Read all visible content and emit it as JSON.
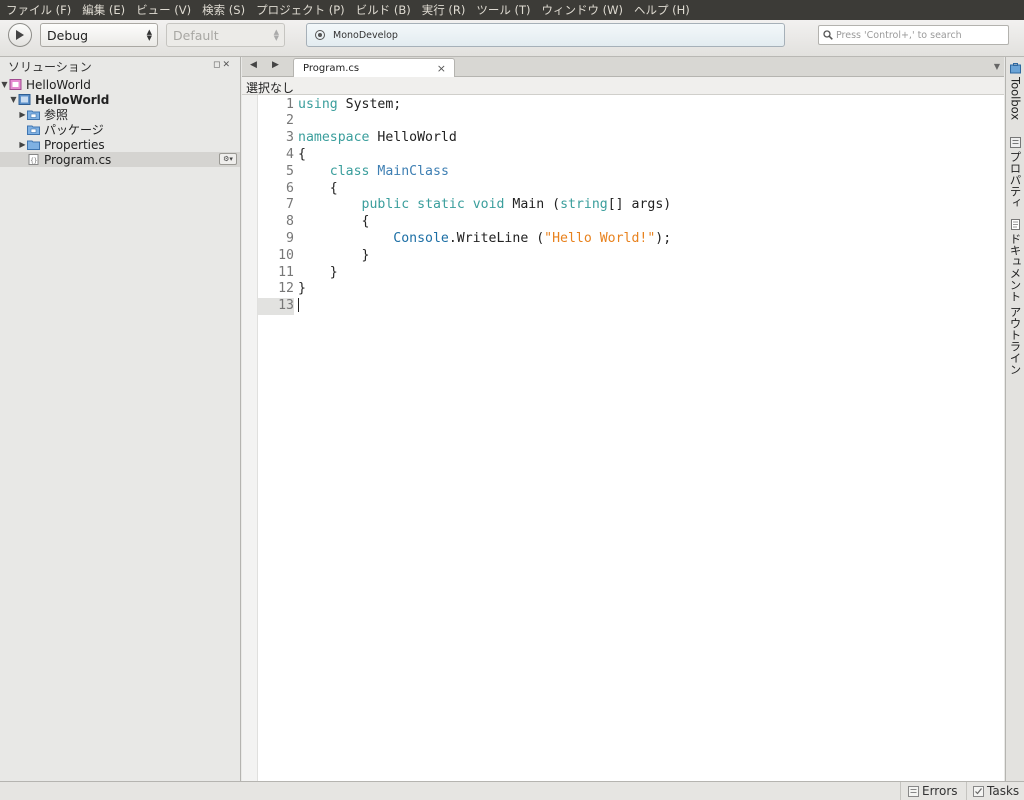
{
  "menu": [
    "ファイル (F)",
    "編集 (E)",
    "ビュー (V)",
    "検索 (S)",
    "プロジェクト (P)",
    "ビルド (B)",
    "実行 (R)",
    "ツール (T)",
    "ウィンドウ (W)",
    "ヘルプ (H)"
  ],
  "toolbar": {
    "config": "Debug",
    "platform": "Default",
    "status": "MonoDevelop",
    "search_placeholder": "Press 'Control+,' to search"
  },
  "solution_pad": {
    "title": "ソリューション",
    "items": [
      {
        "label": "HelloWorld",
        "bold": false
      },
      {
        "label": "HelloWorld",
        "bold": true
      },
      {
        "label": "参照",
        "bold": false
      },
      {
        "label": "パッケージ",
        "bold": false
      },
      {
        "label": "Properties",
        "bold": false
      },
      {
        "label": "Program.cs",
        "bold": false
      }
    ]
  },
  "editor": {
    "tab": "Program.cs",
    "breadcrumb": "選択なし",
    "lines": [
      {
        "n": "1",
        "tokens": [
          [
            "kw",
            "using"
          ],
          [
            "p",
            " System;"
          ]
        ]
      },
      {
        "n": "2",
        "tokens": []
      },
      {
        "n": "3",
        "tokens": [
          [
            "kw",
            "namespace"
          ],
          [
            "p",
            " HelloWorld"
          ]
        ]
      },
      {
        "n": "4",
        "tokens": [
          [
            "p",
            "{"
          ]
        ]
      },
      {
        "n": "5",
        "tokens": [
          [
            "p",
            "    "
          ],
          [
            "kw",
            "class"
          ],
          [
            "p",
            " "
          ],
          [
            "kwb",
            "MainClass"
          ]
        ]
      },
      {
        "n": "6",
        "tokens": [
          [
            "p",
            "    {"
          ]
        ]
      },
      {
        "n": "7",
        "tokens": [
          [
            "p",
            "        "
          ],
          [
            "kw",
            "public"
          ],
          [
            "p",
            " "
          ],
          [
            "kw",
            "static"
          ],
          [
            "p",
            " "
          ],
          [
            "kw",
            "void"
          ],
          [
            "p",
            " Main ("
          ],
          [
            "kw",
            "string"
          ],
          [
            "p",
            "[] args)"
          ]
        ]
      },
      {
        "n": "8",
        "tokens": [
          [
            "p",
            "        {"
          ]
        ]
      },
      {
        "n": "9",
        "tokens": [
          [
            "p",
            "            "
          ],
          [
            "ty",
            "Console"
          ],
          [
            "p",
            ".WriteLine ("
          ],
          [
            "str",
            "\"Hello World!\""
          ],
          [
            "p",
            ");"
          ]
        ]
      },
      {
        "n": "10",
        "tokens": [
          [
            "p",
            "        }"
          ]
        ]
      },
      {
        "n": "11",
        "tokens": [
          [
            "p",
            "    }"
          ]
        ]
      },
      {
        "n": "12",
        "tokens": [
          [
            "p",
            "}"
          ]
        ]
      },
      {
        "n": "13",
        "tokens": []
      }
    ]
  },
  "right_dock": [
    "Toolbox",
    "プロパティ",
    "ドキュメント アウトライン"
  ],
  "statusbar": {
    "errors": "Errors",
    "tasks": "Tasks"
  },
  "colors": {
    "keyword": "#3a9e9c",
    "type": "#3e7fb3",
    "string": "#e8821e",
    "menubar": "#3c3b37"
  }
}
